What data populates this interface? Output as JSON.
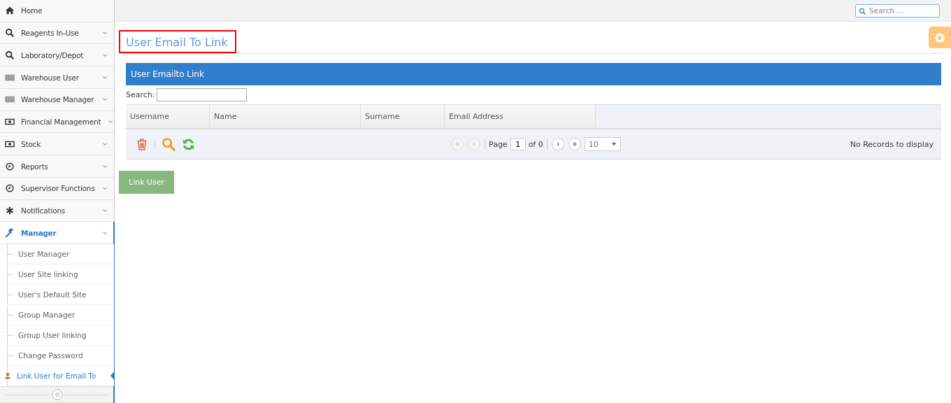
{
  "sidebar": {
    "items": [
      {
        "label": "Home",
        "kind": "home",
        "expandable": false,
        "expanded": false
      },
      {
        "label": "Reagents In-Use",
        "kind": "search",
        "expandable": true,
        "expanded": false
      },
      {
        "label": "Laboratory/Depot",
        "kind": "search",
        "expandable": true,
        "expanded": false
      },
      {
        "label": "Warehouse User",
        "kind": "barcode",
        "expandable": true,
        "expanded": false
      },
      {
        "label": "Warehouse Manager",
        "kind": "barcode",
        "expandable": true,
        "expanded": false
      },
      {
        "label": "Financial Management",
        "kind": "money",
        "expandable": true,
        "expanded": false
      },
      {
        "label": "Stock",
        "kind": "money",
        "expandable": true,
        "expanded": false
      },
      {
        "label": "Reports",
        "kind": "clock",
        "expandable": true,
        "expanded": false
      },
      {
        "label": "Supervisor Functions",
        "kind": "clock",
        "expandable": true,
        "expanded": false
      },
      {
        "label": "Notifications",
        "kind": "asterisk",
        "expandable": true,
        "expanded": false
      },
      {
        "label": "Manager",
        "kind": "wrench",
        "expandable": true,
        "expanded": true,
        "children": [
          {
            "label": "User Manager",
            "selected": false
          },
          {
            "label": "User Site linking",
            "selected": false
          },
          {
            "label": "User's Default Site",
            "selected": false
          },
          {
            "label": "Group Manager",
            "selected": false
          },
          {
            "label": "Group User linking",
            "selected": false
          },
          {
            "label": "Change Password",
            "selected": false
          },
          {
            "label": "Link User for Email To",
            "selected": true
          }
        ]
      }
    ]
  },
  "topbar": {
    "search": {
      "placeholder": "Search ..."
    }
  },
  "page": {
    "title": "User Email To Link",
    "highlighted": true
  },
  "grid": {
    "caption": "User Emailto Link",
    "search_label": "Search:",
    "columns": [
      "Username",
      "Name",
      "Surname",
      "Email Address"
    ],
    "pager": {
      "buttons": [
        {
          "kind": "first",
          "disabled": true
        },
        {
          "kind": "prev",
          "disabled": true
        },
        {
          "kind": "next",
          "disabled": false
        },
        {
          "kind": "last",
          "disabled": false
        }
      ],
      "page_label": "Page",
      "page": "1",
      "of_label": "of 0",
      "page_size": "10"
    },
    "status": "No Records to display"
  },
  "actions": [
    "Link User"
  ]
}
